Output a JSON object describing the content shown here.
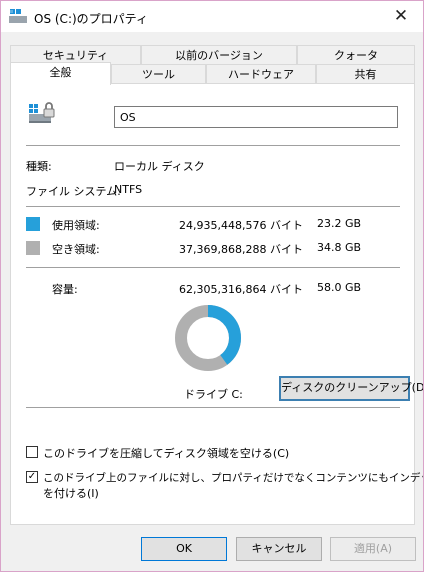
{
  "window": {
    "title": "OS (C:)のプロパティ",
    "close_glyph": "✕"
  },
  "tabs_row1": [
    "セキュリティ",
    "以前のバージョン",
    "クォータ"
  ],
  "tabs_row2": [
    "全般",
    "ツール",
    "ハードウェア",
    "共有"
  ],
  "active_tab": "全般",
  "general": {
    "name_value": "OS",
    "type_label": "種類:",
    "type_value": "ローカル ディスク",
    "fs_label": "ファイル システム:",
    "fs_value": "NTFS",
    "used_label": "使用領域:",
    "used_bytes": "24,935,448,576 バイト",
    "used_gb": "23.2 GB",
    "free_label": "空き領域:",
    "free_bytes": "37,369,868,288 バイト",
    "free_gb": "34.8 GB",
    "capacity_label": "容量:",
    "capacity_bytes": "62,305,316,864 バイト",
    "capacity_gb": "58.0 GB",
    "drive_label": "ドライブ C:",
    "cleanup_button": "ディスクのクリーンアップ(D)",
    "compress_label": "このドライブを圧縮してディスク領域を空ける(C)",
    "compress_checked": false,
    "index_label_line1": "このドライブ上のファイルに対し、プロパティだけでなくコンテンツにもインデックス",
    "index_label_line2": "を付ける(I)",
    "index_checked": true
  },
  "usage": {
    "used_fraction": 0.4
  },
  "colors": {
    "used": "#26a0da",
    "free": "#b0b0b0"
  },
  "buttons": {
    "ok": "OK",
    "cancel": "キャンセル",
    "apply": "適用(A)"
  }
}
